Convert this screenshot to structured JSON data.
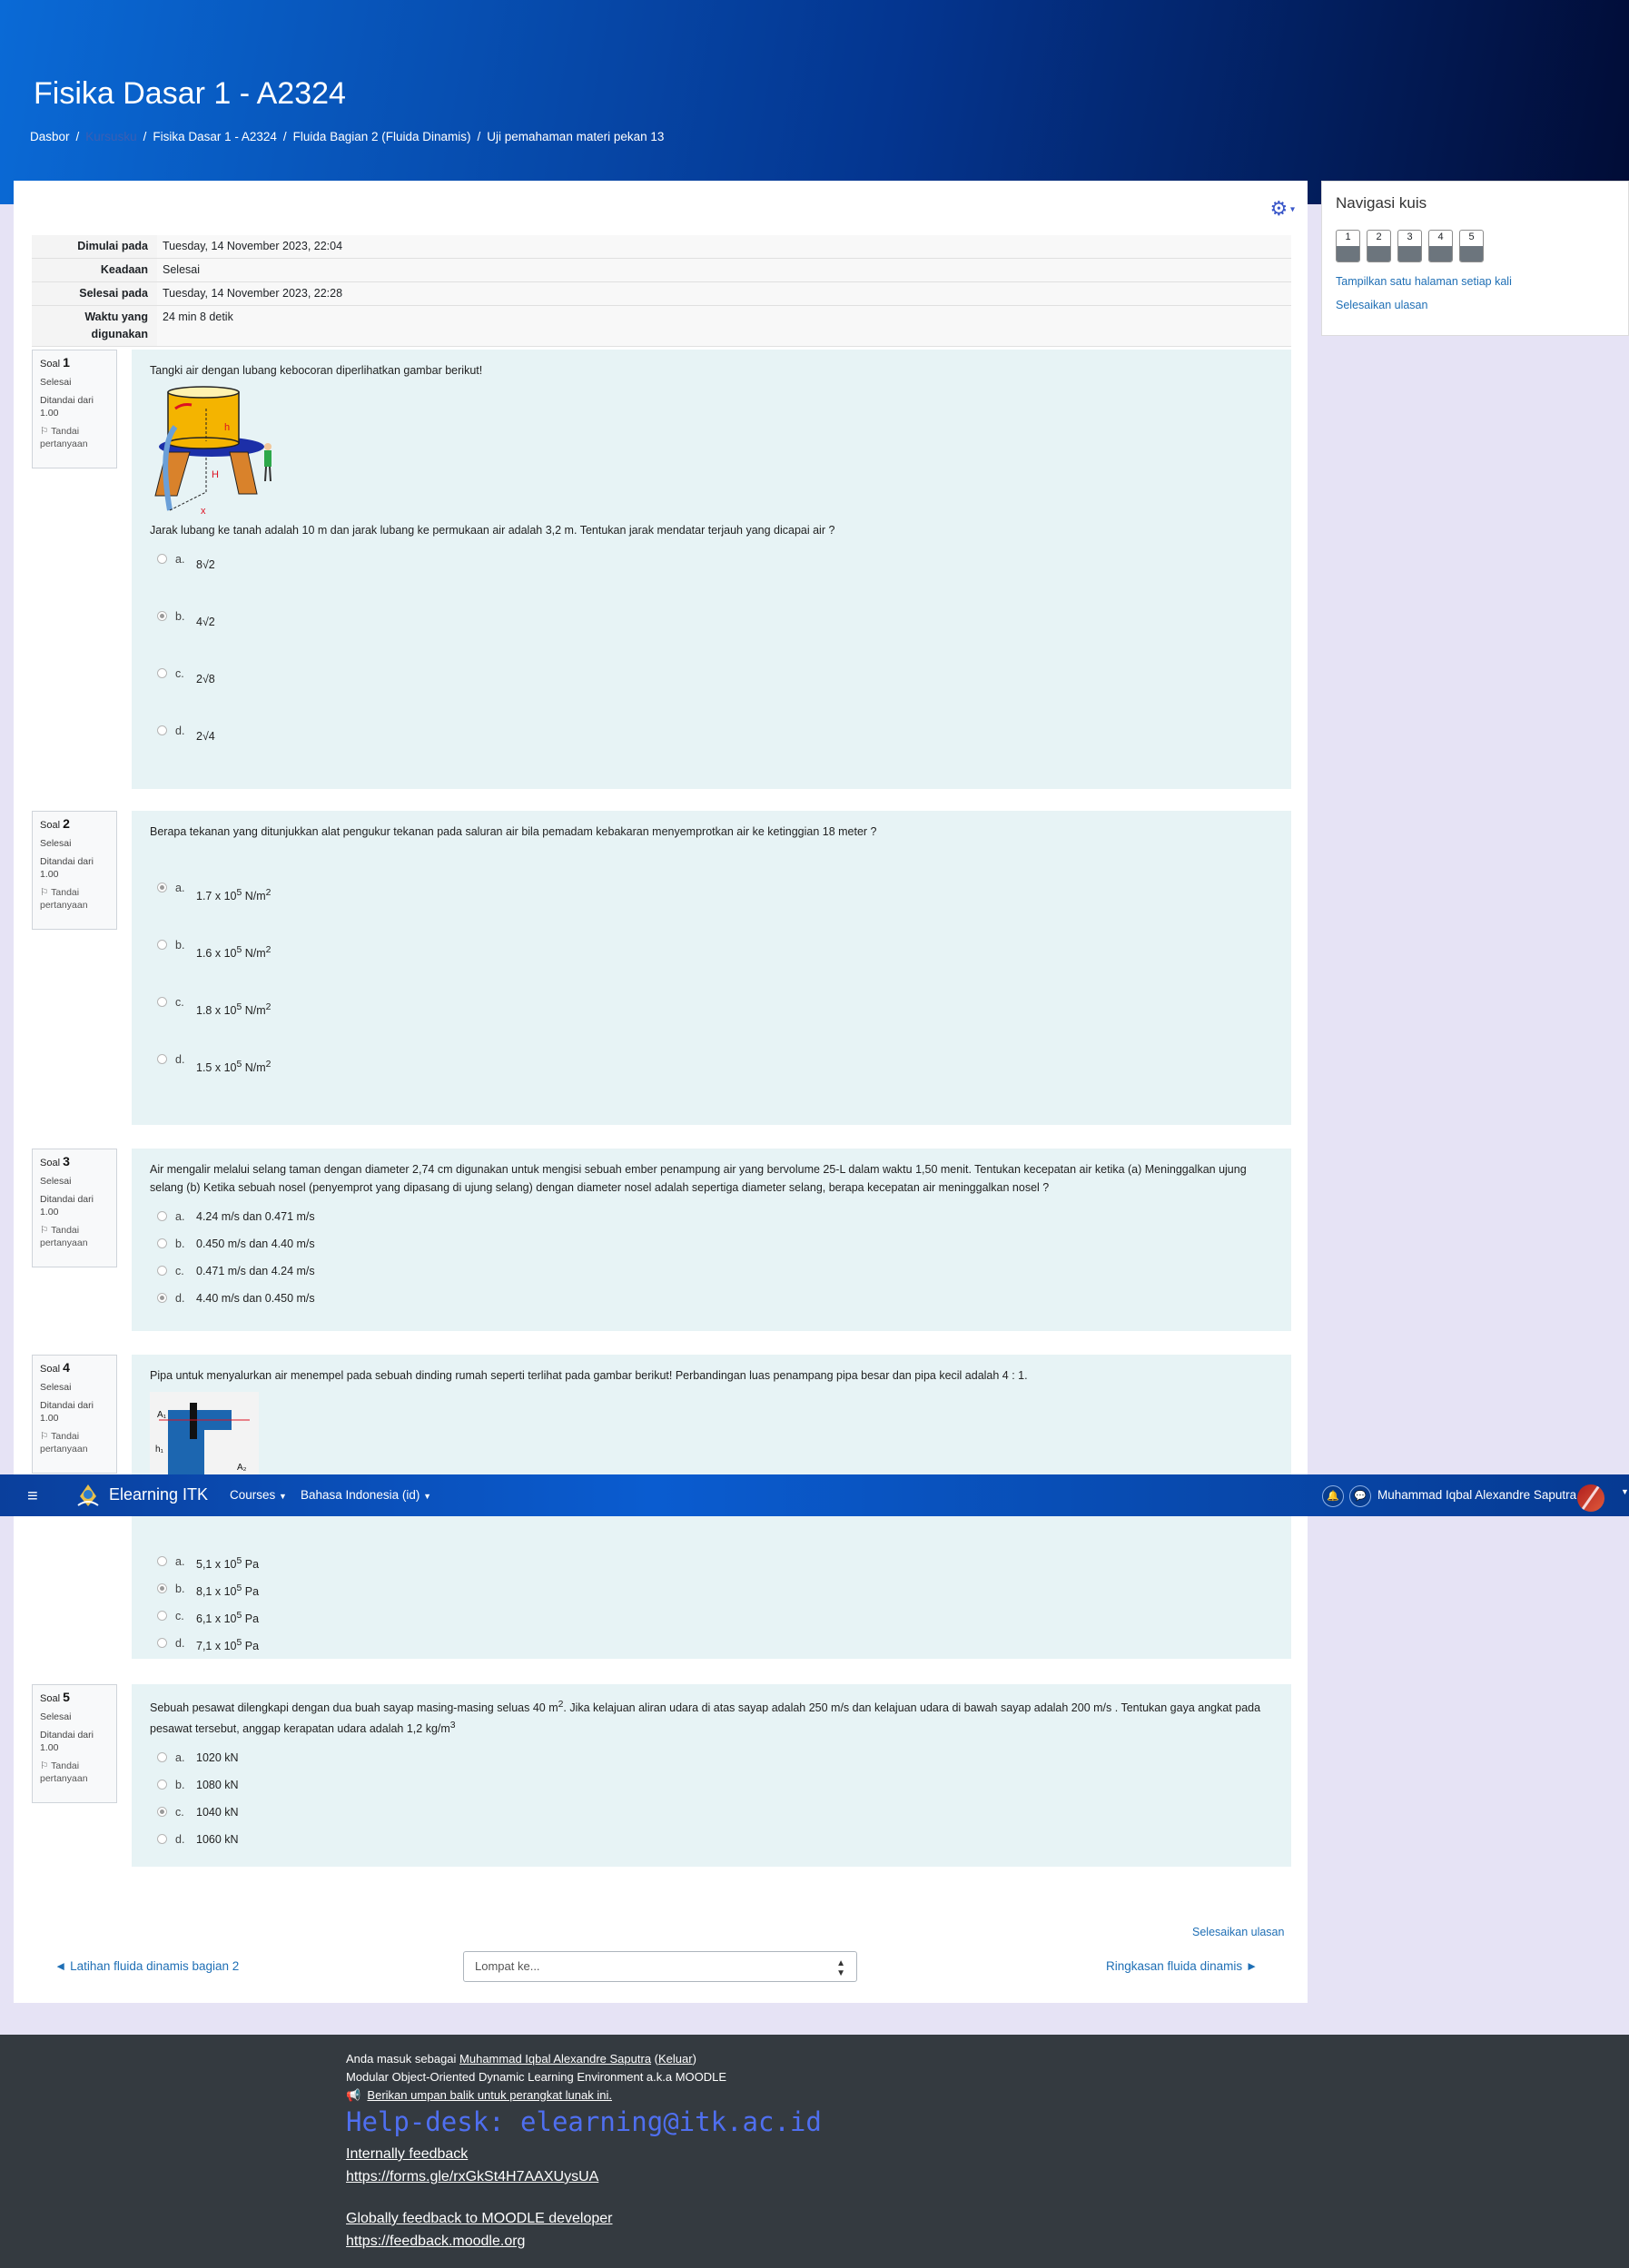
{
  "header": {
    "course_title": "Fisika Dasar 1 - A2324",
    "breadcrumb": [
      "Dasbor",
      "Kursusku",
      "Fisika Dasar 1 - A2324",
      "Fluida Bagian 2 (Fluida Dinamis)",
      "Uji pemahaman materi pekan 13"
    ]
  },
  "summary": {
    "rows": [
      {
        "label": "Dimulai pada",
        "value": "Tuesday, 14 November 2023, 22:04"
      },
      {
        "label": "Keadaan",
        "value": "Selesai"
      },
      {
        "label": "Selesai pada",
        "value": "Tuesday, 14 November 2023, 22:28"
      },
      {
        "label": "Waktu yang digunakan",
        "value": "24 min 8 detik"
      }
    ]
  },
  "question_info": {
    "soal": "Soal",
    "status": "Selesai",
    "mark": "Ditandai dari 1.00",
    "flag": "Tandai pertanyaan"
  },
  "questions": [
    {
      "no": "1",
      "text": "Tangki air dengan lubang kebocoran diperlihatkan gambar berikut!",
      "text2": "Jarak lubang ke tanah adalah 10 m dan jarak lubang ke permukaan air adalah 3,2 m. Tentukan jarak mendatar terjauh yang dicapai air ?",
      "fig_labels": {
        "h": "h",
        "H": "H",
        "x": "x"
      },
      "options": [
        {
          "l": "a.",
          "t": "8√2"
        },
        {
          "l": "b.",
          "t": "4√2"
        },
        {
          "l": "c.",
          "t": "2√8"
        },
        {
          "l": "d.",
          "t": "2√4"
        }
      ]
    },
    {
      "no": "2",
      "text": "Berapa tekanan yang ditunjukkan alat pengukur tekanan pada saluran air bila pemadam kebakaran menyemprotkan air ke ketinggian 18 meter ?",
      "options": [
        {
          "l": "a.",
          "t": "1.7 x 10",
          "e": "5",
          "u": " N/m",
          "e2": "2"
        },
        {
          "l": "b.",
          "t": "1.6 x 10",
          "e": "5",
          "u": " N/m",
          "e2": "2"
        },
        {
          "l": "c.",
          "t": "1.8 x 10",
          "e": "5",
          "u": " N/m",
          "e2": "2"
        },
        {
          "l": "d.",
          "t": "1.5 x 10",
          "e": "5",
          "u": " N/m",
          "e2": "2"
        }
      ]
    },
    {
      "no": "3",
      "text": "Air mengalir melalui selang taman dengan diameter 2,74 cm digunakan untuk mengisi sebuah ember penampung air yang bervolume 25-L dalam waktu 1,50 menit. Tentukan kecepatan air ketika (a) Meninggalkan ujung selang (b) Ketika sebuah nosel (penyemprot yang dipasang di ujung selang) dengan diameter nosel adalah sepertiga diameter selang, berapa kecepatan air meninggalkan nosel ?",
      "options": [
        {
          "l": "a.",
          "t": "4.24 m/s dan 0.471 m/s"
        },
        {
          "l": "b.",
          "t": "0.450 m/s dan 4.40 m/s"
        },
        {
          "l": "c.",
          "t": "0.471 m/s dan 4.24 m/s"
        },
        {
          "l": "d.",
          "t": "4.40 m/s dan 0.450 m/s"
        }
      ]
    },
    {
      "no": "4",
      "text": "Pipa untuk menyalurkan air menempel pada sebuah dinding rumah seperti terlihat pada gambar berikut! Perbandingan luas penampang pipa besar dan pipa kecil adalah 4 : 1.",
      "fig_labels": {
        "a1": "A₁",
        "a2": "A₂",
        "h1": "h₁"
      },
      "options": [
        {
          "l": "a.",
          "t": "5,1 x 10",
          "e": "5",
          "u": " Pa"
        },
        {
          "l": "b.",
          "t": "8,1 x 10",
          "e": "5",
          "u": " Pa"
        },
        {
          "l": "c.",
          "t": "6,1 x 10",
          "e": "5",
          "u": " Pa"
        },
        {
          "l": "d.",
          "t": "7,1 x 10",
          "e": "5",
          "u": " Pa"
        }
      ]
    },
    {
      "no": "5",
      "text_a": "Sebuah pesawat dilengkapi dengan dua buah sayap masing-masing seluas 40 m",
      "text_sup": "2",
      "text_b": ". Jika kelajuan aliran udara di atas sayap adalah 250 m/s dan kelajuan udara di bawah sayap adalah 200 m/s . Tentukan gaya angkat pada pesawat tersebut, anggap kerapatan udara adalah 1,2 kg/m",
      "text_sup2": "3",
      "options": [
        {
          "l": "a.",
          "t": "1020 kN"
        },
        {
          "l": "b.",
          "t": "1080 kN"
        },
        {
          "l": "c.",
          "t": "1040 kN"
        },
        {
          "l": "d.",
          "t": "1060 kN"
        }
      ]
    }
  ],
  "nav": {
    "brand": "Elearning ITK",
    "courses": "Courses",
    "language": "Bahasa Indonesia (id)",
    "user": "Muhammad Iqbal Alexandre Saputra"
  },
  "sidebar": {
    "title": "Navigasi kuis",
    "buttons": [
      "1",
      "2",
      "3",
      "4",
      "5"
    ],
    "show_one_page": "Tampilkan satu halaman setiap kali",
    "finish_review": "Selesaikan ulasan"
  },
  "bottom": {
    "finish_review": "Selesaikan ulasan",
    "prev": "◄ Latihan fluida dinamis bagian 2",
    "next": "Ringkasan fluida dinamis ►",
    "jump_placeholder": "Lompat ke..."
  },
  "footer": {
    "logged_in_prefix": "Anda masuk sebagai ",
    "user": "Muhammad Iqbal Alexandre Saputra",
    "logout": "Keluar",
    "moodle": "Modular Object-Oriented Dynamic Learning Environment a.k.a MOODLE",
    "feedback": "Berikan umpan balik untuk perangkat lunak ini.",
    "helpdesk": "Help-desk: elearning@itk.ac.id",
    "internal_title": "Internally feedback",
    "internal_url": "https://forms.gle/rxGkSt4H7AAXUysUA",
    "global_title": "Globally feedback to MOODLE developer",
    "global_url": "https://feedback.moodle.org"
  }
}
